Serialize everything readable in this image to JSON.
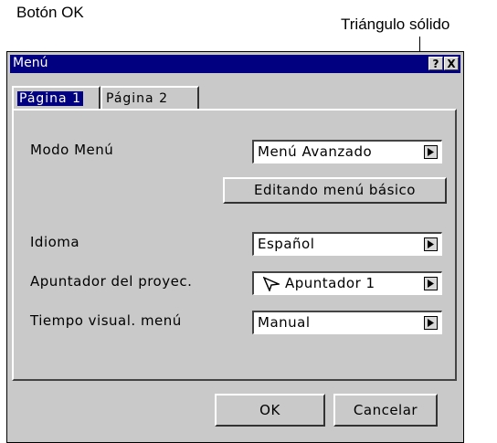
{
  "annotations": {
    "ok_button": "Botón OK",
    "solid_triangle": "Triángulo sólido"
  },
  "window": {
    "title": "Menú",
    "help_label": "?",
    "close_label": "X"
  },
  "tabs": [
    {
      "label": "Página 1",
      "selected": true
    },
    {
      "label": "Página 2",
      "selected": false
    }
  ],
  "settings": {
    "menu_mode": {
      "label": "Modo Menú",
      "value": "Menú Avanzado"
    },
    "edit_button": "Editando menú básico",
    "language": {
      "label": "Idioma",
      "value": "Español"
    },
    "pointer": {
      "label": "Apuntador del proyec.",
      "value": "Apuntador 1",
      "icon": "pointer-arrow-icon"
    },
    "menu_display_time": {
      "label": "Tiempo visual. menú",
      "value": "Manual"
    }
  },
  "footer": {
    "ok_label": "OK",
    "cancel_label": "Cancelar"
  },
  "colors": {
    "titlebar": "#000080",
    "dialog_bg": "#c9c9c9"
  }
}
